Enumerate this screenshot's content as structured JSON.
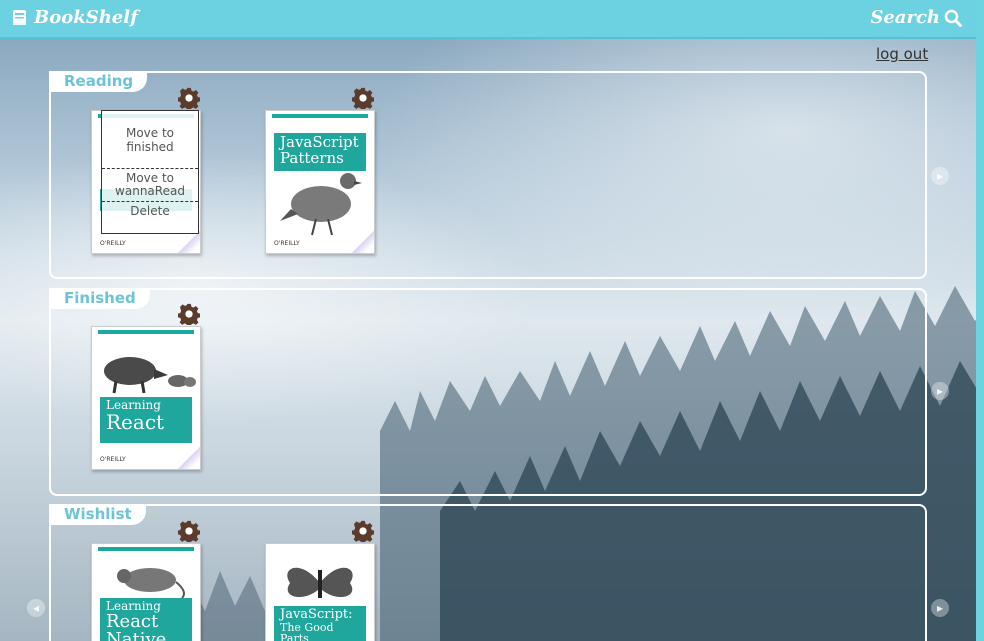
{
  "header": {
    "brand": "BookShelf",
    "search_label": "Search",
    "bg_color": "#6cd1e1"
  },
  "logout_label": "log out",
  "shelves": [
    {
      "name": "Reading",
      "books": [
        {
          "title": "",
          "menu_open": true
        },
        {
          "title_line1": "JavaScript",
          "title_line2": "Patterns",
          "publisher": "O'REILLY"
        }
      ]
    },
    {
      "name": "Finished",
      "books": [
        {
          "title_line1": "Learning",
          "title_line2": "React",
          "publisher": "O'REILLY"
        }
      ]
    },
    {
      "name": "Wishlist",
      "books": [
        {
          "title_line1": "Learning",
          "title_line2": "React Native"
        },
        {
          "title_line1": "JavaScript:",
          "title_line2": "The Good Parts"
        }
      ]
    }
  ],
  "book_menu": {
    "move_finished": "Move to finished",
    "move_wanna": "Move to wannaRead",
    "delete": "Delete"
  },
  "icons": {
    "gear": "gear-icon",
    "book": "book-icon",
    "search": "search-icon",
    "arrow": "chevron-right-icon"
  },
  "colors": {
    "accent": "#6cc4d6",
    "gear": "#5a3b2c",
    "cover": "#1fa79e"
  }
}
